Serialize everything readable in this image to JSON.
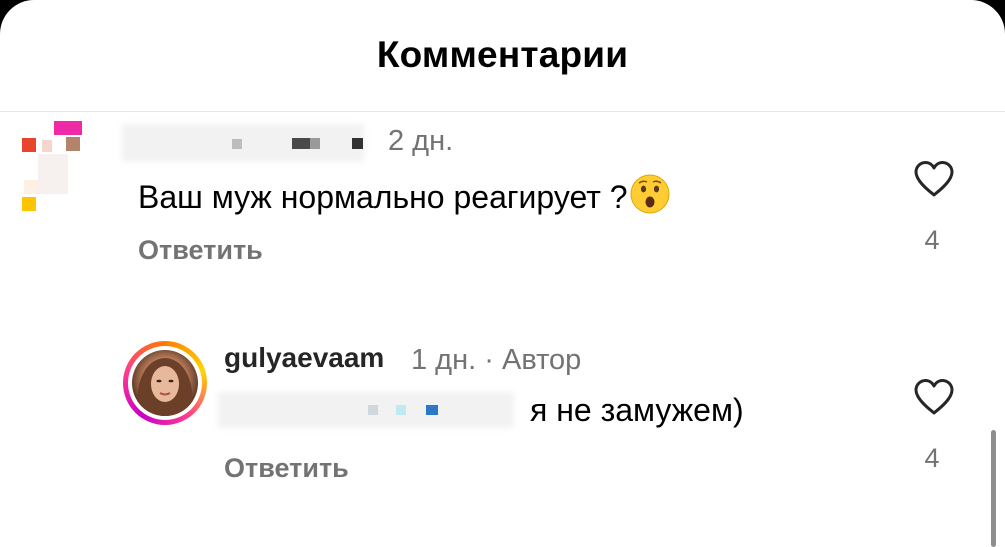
{
  "header": {
    "title": "Комментарии"
  },
  "comments": [
    {
      "time": "2 дн.",
      "text": "Ваш муж нормально реагирует ?",
      "emoji": "hushed-face-emoji",
      "reply_label": "Ответить",
      "likes": "4"
    },
    {
      "username": "gulyaevaam",
      "time": "1 дн.",
      "separator": "·",
      "author_badge": "Автор",
      "text": "я не замужем)",
      "reply_label": "Ответить",
      "likes": "4"
    }
  ],
  "colors": {
    "secondary_text": "#737373",
    "primary_text": "#000000",
    "divider": "#e6e6e6",
    "ring_start": "#ff7a00",
    "ring_end": "#c800c8"
  },
  "icons": [
    "heart-outline-icon",
    "hushed-face-emoji"
  ]
}
